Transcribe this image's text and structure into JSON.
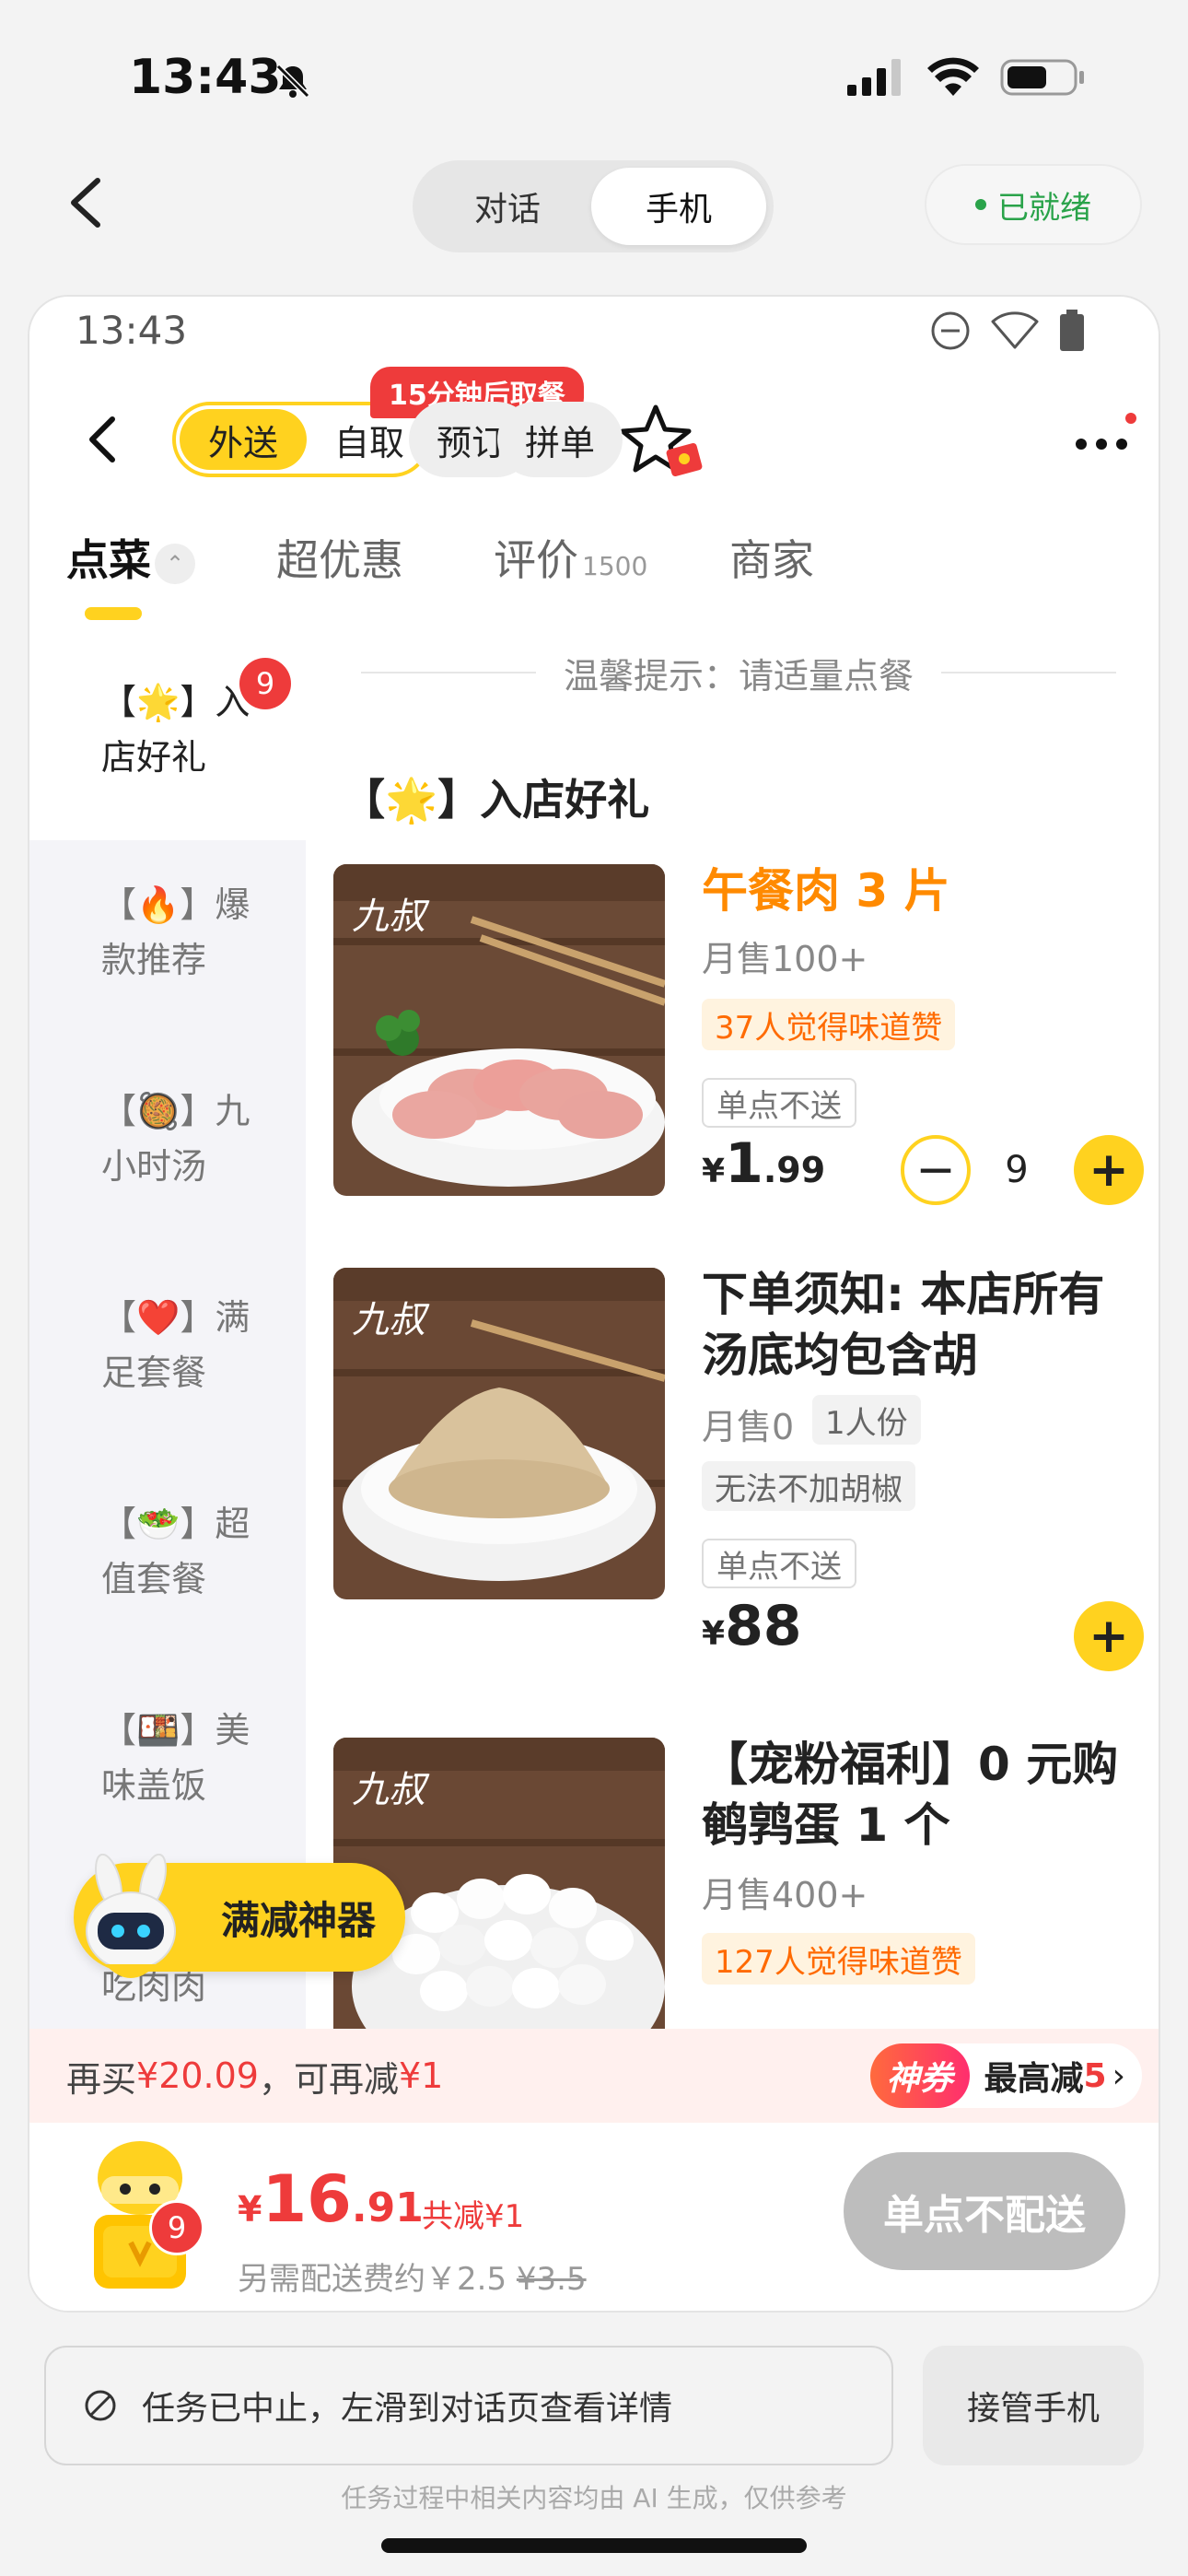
{
  "os_status": {
    "time": "13:43"
  },
  "top_bar": {
    "tabs": [
      {
        "label": "对话"
      },
      {
        "label": "手机"
      }
    ],
    "status": "已就绪"
  },
  "phone": {
    "status_time": "13:43",
    "header": {
      "mode_active": "外送",
      "mode_other": "自取",
      "pickup_badge": "15分钟后取餐",
      "reserve": "预订",
      "group": "拼单"
    },
    "tabs": [
      {
        "label": "点菜",
        "extra": ""
      },
      {
        "label": "超优惠",
        "extra": ""
      },
      {
        "label": "评价",
        "extra": "1500"
      },
      {
        "label": "商家",
        "extra": ""
      }
    ],
    "categories": [
      {
        "label": "【🌟】入店好礼",
        "badge": "9"
      },
      {
        "label": "【🔥】爆款推荐"
      },
      {
        "label": "【🥘】九小时汤"
      },
      {
        "label": "【❤️】满足套餐"
      },
      {
        "label": "【🥗】超值套餐"
      },
      {
        "label": "【🍱】美味盖饭"
      },
      {
        "label": "吃肉肉"
      }
    ],
    "tip": "温馨提示：请适量点餐",
    "section_title": "【🌟】入店好礼",
    "items": [
      {
        "name": "午餐肉 3 片",
        "sales": "月售100+",
        "like": "37人觉得味道赞",
        "note": "单点不送",
        "price_yen": "¥",
        "price_int": "1",
        "price_dec": ".99",
        "qty": "9"
      },
      {
        "name": "下单须知: 本店所有汤底均包含胡",
        "sales": "月售0",
        "portion": "1人份",
        "spec": "无法不加胡椒",
        "note": "单点不送",
        "price_yen": "¥",
        "price_int": "88"
      },
      {
        "name": "【宠粉福利】0 元购鹌鹑蛋 1 个",
        "sales": "月售400+",
        "like": "127人觉得味道赞"
      }
    ],
    "float_discount": "满减神器",
    "promo": {
      "prefix": "再买",
      "amount": "¥20.09",
      "mid": "，可再减",
      "save": "¥1",
      "coupon_tag": "神券",
      "coupon_text": "最高减",
      "coupon_num": "5"
    },
    "cart": {
      "badge": "9",
      "price_yen": "¥",
      "price_int": "16",
      "price_dec": ".91",
      "save": "共减¥1",
      "fee_prefix": "另需配送费约￥2.5",
      "fee_old": "¥3.5",
      "button": "单点不配送"
    }
  },
  "bottom": {
    "task_text": "任务已中止，左滑到对话页查看详情",
    "takeover": "接管手机",
    "disclaimer": "任务过程中相关内容均由 AI 生成，仅供参考"
  }
}
